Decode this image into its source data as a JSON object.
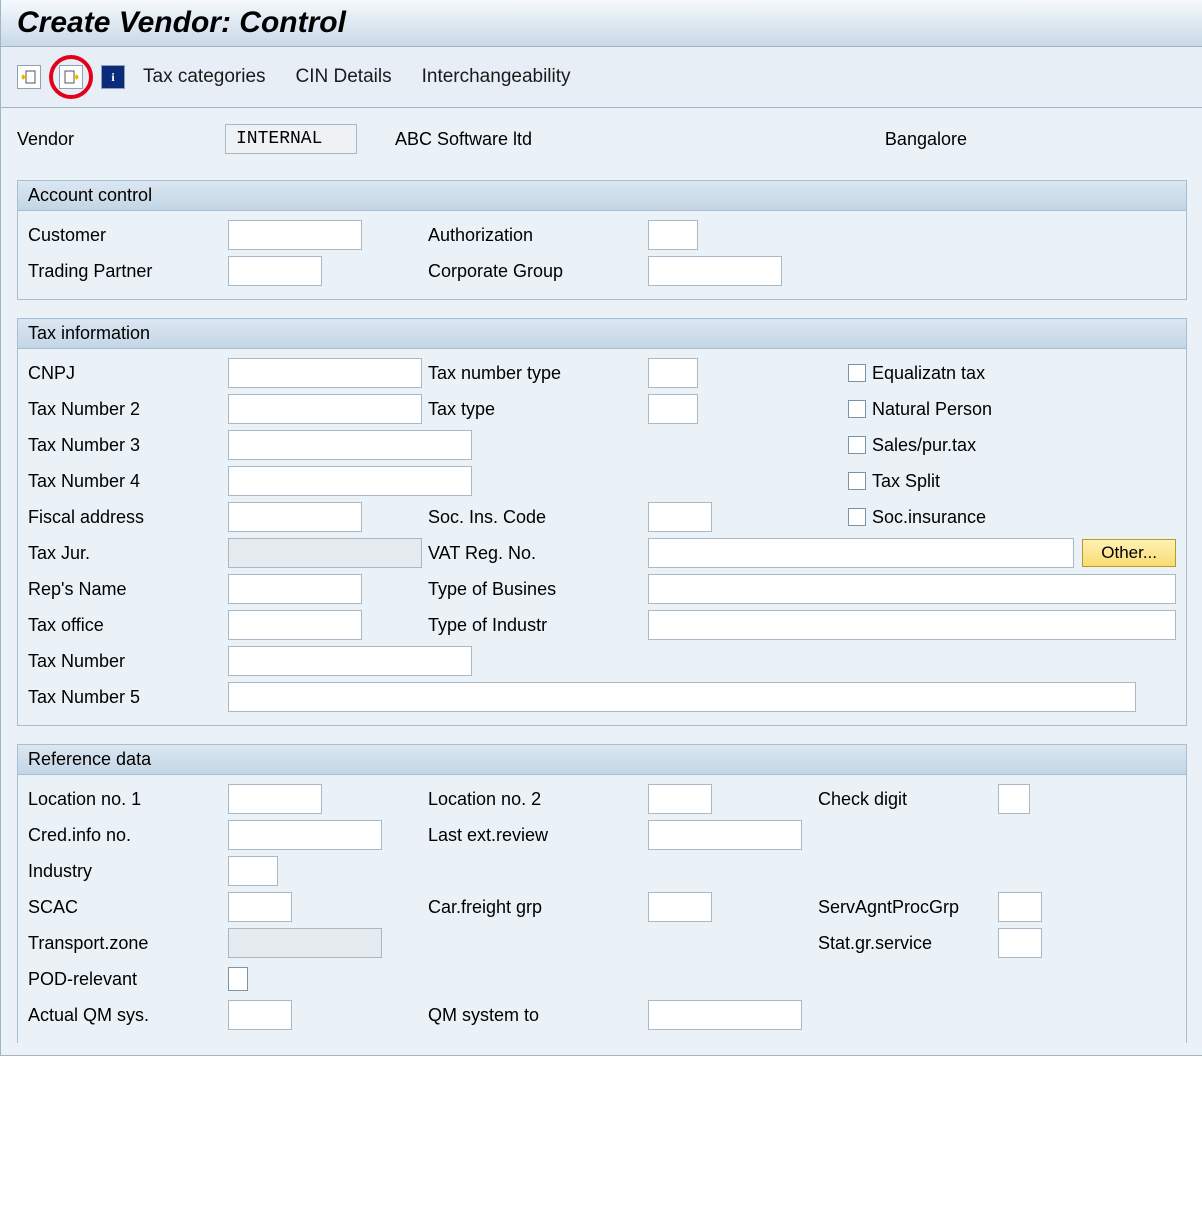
{
  "title": "Create Vendor: Control",
  "toolbar": {
    "tax_categories": "Tax categories",
    "cin_details": "CIN Details",
    "interchangeability": "Interchangeability"
  },
  "vendor": {
    "label": "Vendor",
    "id": "INTERNAL",
    "name": "ABC Software ltd",
    "city": "Bangalore"
  },
  "account_control": {
    "title": "Account control",
    "customer": "Customer",
    "trading_partner": "Trading Partner",
    "authorization": "Authorization",
    "corporate_group": "Corporate Group"
  },
  "tax_info": {
    "title": "Tax information",
    "cnpj": "CNPJ",
    "tax_number_2": "Tax Number 2",
    "tax_number_3": "Tax Number 3",
    "tax_number_4": "Tax Number 4",
    "fiscal_address": "Fiscal address",
    "tax_jur": "Tax Jur.",
    "reps_name": "Rep's Name",
    "tax_office": "Tax office",
    "tax_number": "Tax Number",
    "tax_number_5": "Tax Number 5",
    "tax_number_type": "Tax number type",
    "tax_type": "Tax type",
    "soc_ins_code": "Soc. Ins. Code",
    "vat_reg_no": "VAT Reg. No.",
    "type_of_business": "Type of Busines",
    "type_of_industry": "Type of Industr",
    "equalizatn_tax": "Equalizatn tax",
    "natural_person": "Natural Person",
    "sales_pur_tax": "Sales/pur.tax",
    "tax_split": "Tax Split",
    "soc_insurance": "Soc.insurance",
    "other_btn": "Other..."
  },
  "reference_data": {
    "title": "Reference data",
    "location_no_1": "Location no. 1",
    "location_no_2": "Location no. 2",
    "check_digit": "Check digit",
    "cred_info_no": "Cred.info no.",
    "last_ext_review": "Last ext.review",
    "industry": "Industry",
    "scac": "SCAC",
    "car_freight_grp": "Car.freight grp",
    "serv_agnt_proc_grp": "ServAgntProcGrp",
    "transport_zone": "Transport.zone",
    "stat_gr_service": "Stat.gr.service",
    "pod_relevant": "POD-relevant",
    "actual_qm_sys": "Actual QM sys.",
    "qm_system_to": "QM system to"
  }
}
